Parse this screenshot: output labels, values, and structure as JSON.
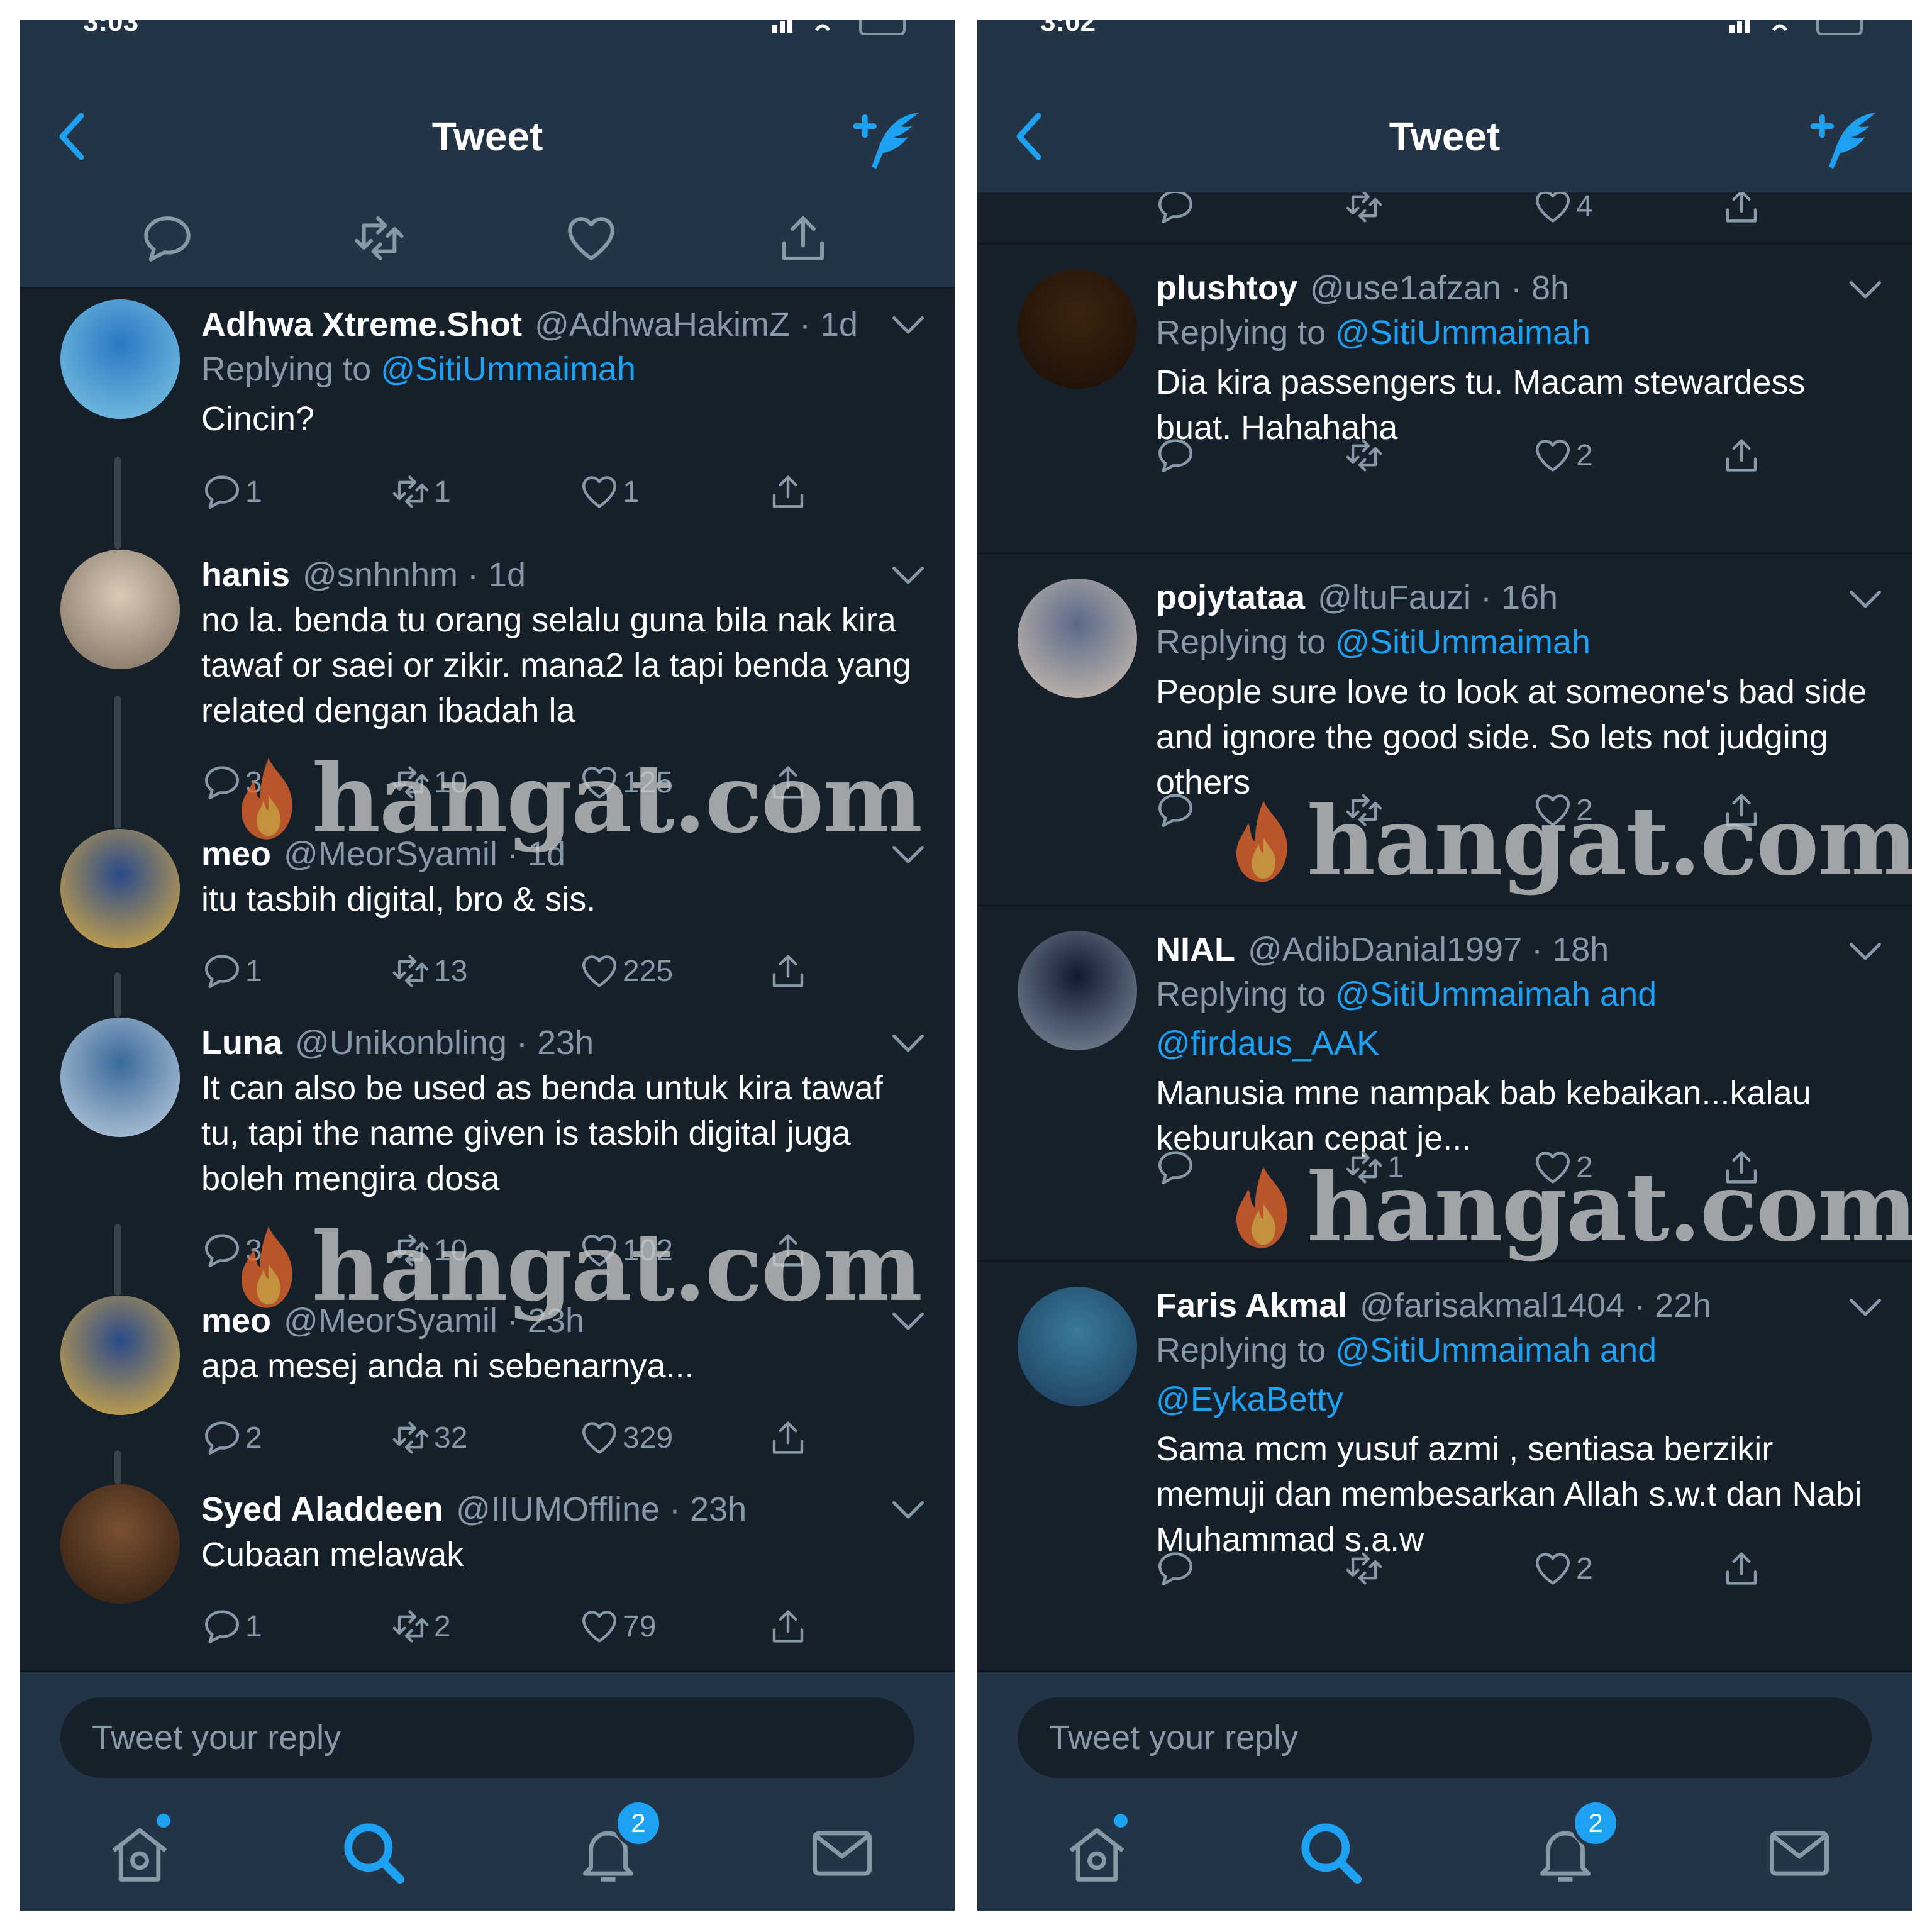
{
  "left": {
    "status_time": "3:03",
    "title": "Tweet",
    "tweets": [
      {
        "name": "Adhwa Xtreme.Shot",
        "handle": "@AdhwaHakimZ",
        "time": "1d",
        "replying_to": "Replying to",
        "mentions": "@SitiUmmaimah",
        "text": "Cincin?",
        "replies": "1",
        "retweets": "1",
        "likes": "1"
      },
      {
        "name": "hanis",
        "handle": "@snhnhm",
        "time": "1d",
        "text": "no la. benda tu orang selalu guna bila nak kira tawaf or saei or zikir. mana2 la tapi benda yang related dengan ibadah la",
        "replies": "3",
        "retweets": "10",
        "likes": "125"
      },
      {
        "name": "meo",
        "handle": "@MeorSyamil",
        "time": "1d",
        "text": "itu tasbih digital, bro & sis.",
        "replies": "1",
        "retweets": "13",
        "likes": "225"
      },
      {
        "name": "Luna",
        "handle": "@Unikonbling",
        "time": "23h",
        "text": "It can also be used as benda untuk kira tawaf tu, tapi the name given is tasbih digital juga boleh mengira dosa",
        "replies": "3",
        "retweets": "10",
        "likes": "102"
      },
      {
        "name": "meo",
        "handle": "@MeorSyamil",
        "time": "23h",
        "text": "apa mesej anda ni sebenarnya...",
        "replies": "2",
        "retweets": "32",
        "likes": "329"
      },
      {
        "name": "Syed Aladdeen",
        "handle": "@IIUMOffline",
        "time": "23h",
        "text": "Cubaan melawak",
        "replies": "1",
        "retweets": "2",
        "likes": "79"
      }
    ],
    "reply_placeholder": "Tweet your reply",
    "notifications_badge": "2"
  },
  "right": {
    "status_time": "3:02",
    "title": "Tweet",
    "top_likes": "4",
    "tweets": [
      {
        "name": "plushtoy",
        "handle": "@use1afzan",
        "time": "8h",
        "replying_to": "Replying to",
        "mentions": "@SitiUmmaimah",
        "text": "Dia kira passengers tu. Macam stewardess buat. Hahahaha",
        "replies": "",
        "retweets": "",
        "likes": "2"
      },
      {
        "name": "pojytataa",
        "handle": "@ltuFauzi",
        "time": "16h",
        "replying_to": "Replying to",
        "mentions": "@SitiUmmaimah",
        "text": "People sure love to look at someone's bad side and ignore the good side.  So lets not judging others",
        "replies": "",
        "retweets": "",
        "likes": "2"
      },
      {
        "name": "NIAL",
        "handle": "@AdibDanial1997",
        "time": "18h",
        "replying_to": "Replying to",
        "mentions": "@SitiUmmaimah and",
        "mentions2": "@firdaus_AAK",
        "text": "Manusia mne nampak bab kebaikan...kalau keburukan cepat je...",
        "replies": "",
        "retweets": "1",
        "likes": "2"
      },
      {
        "name": "Faris Akmal",
        "handle": "@farisakmal1404",
        "time": "22h",
        "replying_to": "Replying to",
        "mentions": "@SitiUmmaimah and",
        "mentions2": "@EykaBetty",
        "text": "Sama mcm yusuf azmi , sentiasa berzikir memuji dan membesarkan Allah s.w.t dan Nabi Muhammad s.a.w",
        "replies": "",
        "retweets": "",
        "likes": "2"
      }
    ],
    "reply_placeholder": "Tweet your reply",
    "notifications_badge": "2"
  },
  "watermark": "hangat.com",
  "icons": [
    "back-icon",
    "compose-icon",
    "reply-icon",
    "retweet-icon",
    "like-icon",
    "share-icon",
    "chevron-down-icon",
    "home-icon",
    "search-icon",
    "notifications-icon",
    "messages-icon",
    "flame-icon"
  ],
  "colors": {
    "background": "#15202b",
    "bar": "#243447",
    "accent": "#1da1f2",
    "muted": "#8899a6",
    "divider": "#10171e"
  }
}
